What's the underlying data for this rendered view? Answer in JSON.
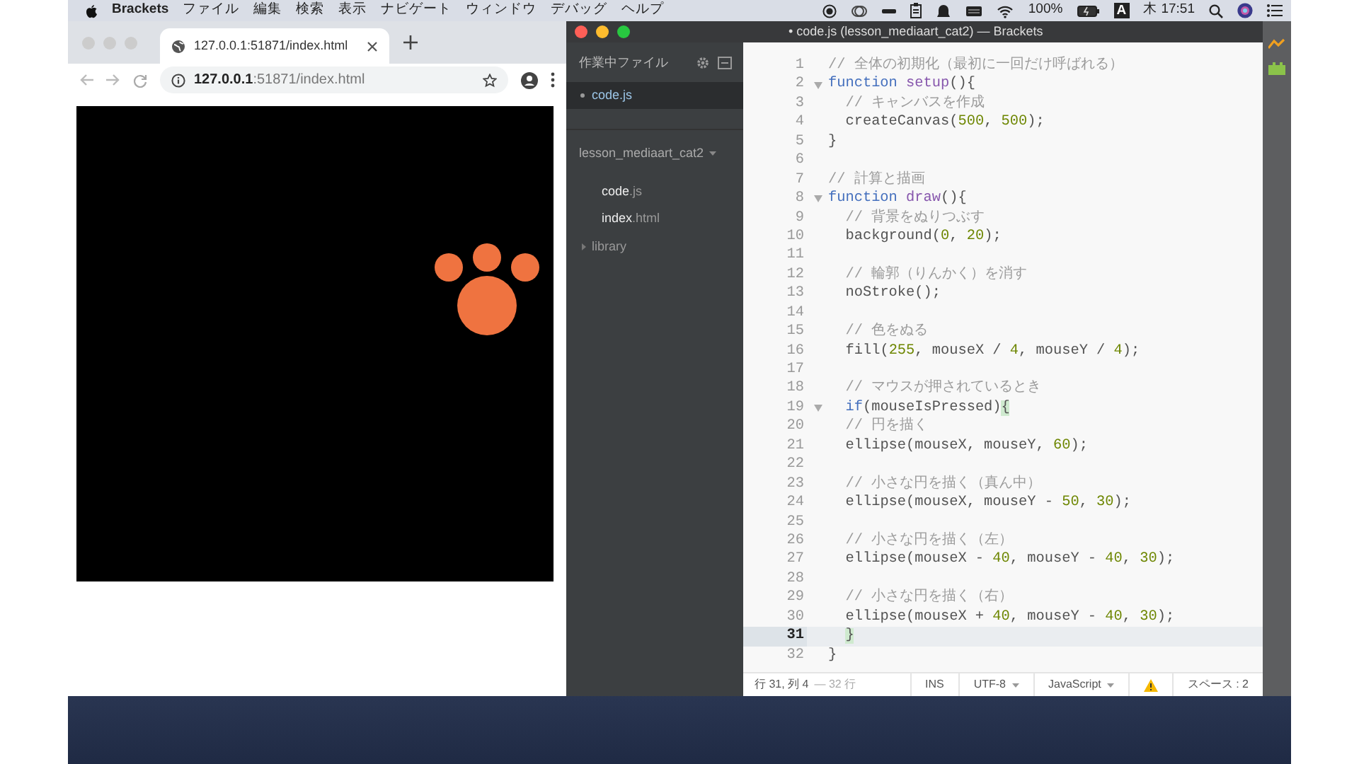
{
  "menu_bar": {
    "app": "Brackets",
    "items": [
      "ファイル",
      "編集",
      "検索",
      "表示",
      "ナビゲート",
      "ウィンドウ",
      "デバッグ",
      "ヘルプ"
    ],
    "battery": "100%",
    "input_source": "A",
    "clock": "木 17:51"
  },
  "browser": {
    "tabs": [
      {
        "title": "127.0.0.1:51871/index.html",
        "selected": true
      }
    ],
    "address": "**127.0.0.1**:51871/index.html"
  },
  "editor": {
    "title": "• code.js (lesson_mediaart_cat2) — Brackets",
    "working_files": {
      "header": "作業中ファイル",
      "files": [
        {
          "name": "code.js",
          "selected": true
        }
      ]
    },
    "project": {
      "name": "lesson_mediaart_cat2",
      "items": [
        {
          "kind": "file",
          "name": "code",
          "ext": ".js"
        },
        {
          "kind": "file",
          "name": "index",
          "ext": ".html"
        },
        {
          "kind": "folder",
          "name": "library",
          "expanded": false
        }
      ]
    },
    "lines": [
      {
        "number": "1",
        "foldable": false,
        "active": false,
        "tokens": [
          {
            "kind": "comment",
            "text": "// 全体の初期化（最初に一回だけ呼ばれる）"
          }
        ]
      },
      {
        "number": "2",
        "foldable": true,
        "active": false,
        "tokens": [
          {
            "kind": "keyword",
            "text": "function "
          },
          {
            "kind": "def",
            "text": "setup"
          },
          {
            "kind": "plain",
            "text": "(){"
          }
        ]
      },
      {
        "number": "3",
        "foldable": false,
        "active": false,
        "tokens": [
          {
            "kind": "comment",
            "text": "  // キャンバスを作成"
          }
        ]
      },
      {
        "number": "4",
        "foldable": false,
        "active": false,
        "tokens": [
          {
            "kind": "plain",
            "text": "  createCanvas("
          },
          {
            "kind": "number",
            "text": "500"
          },
          {
            "kind": "plain",
            "text": ", "
          },
          {
            "kind": "number",
            "text": "500"
          },
          {
            "kind": "plain",
            "text": ");"
          }
        ]
      },
      {
        "number": "5",
        "foldable": false,
        "active": false,
        "tokens": [
          {
            "kind": "plain",
            "text": "}"
          }
        ]
      },
      {
        "number": "6",
        "foldable": false,
        "active": false
      },
      {
        "number": "7",
        "foldable": false,
        "active": false,
        "tokens": [
          {
            "kind": "comment",
            "text": "// 計算と描画"
          }
        ]
      },
      {
        "number": "8",
        "foldable": true,
        "active": false,
        "tokens": [
          {
            "kind": "keyword",
            "text": "function "
          },
          {
            "kind": "def",
            "text": "draw"
          },
          {
            "kind": "plain",
            "text": "(){"
          }
        ]
      },
      {
        "number": "9",
        "foldable": false,
        "active": false,
        "tokens": [
          {
            "kind": "comment",
            "text": "  // 背景をぬりつぶす"
          }
        ]
      },
      {
        "number": "10",
        "foldable": false,
        "active": false,
        "tokens": [
          {
            "kind": "plain",
            "text": "  background("
          },
          {
            "kind": "number",
            "text": "0"
          },
          {
            "kind": "plain",
            "text": ", "
          },
          {
            "kind": "number",
            "text": "20"
          },
          {
            "kind": "plain",
            "text": ");"
          }
        ]
      },
      {
        "number": "11",
        "foldable": false,
        "active": false
      },
      {
        "number": "12",
        "foldable": false,
        "active": false,
        "tokens": [
          {
            "kind": "comment",
            "text": "  // 輪郭（りんかく）を消す"
          }
        ]
      },
      {
        "number": "13",
        "foldable": false,
        "active": false,
        "tokens": [
          {
            "kind": "plain",
            "text": "  noStroke();"
          }
        ]
      },
      {
        "number": "14",
        "foldable": false,
        "active": false
      },
      {
        "number": "15",
        "foldable": false,
        "active": false,
        "tokens": [
          {
            "kind": "comment",
            "text": "  // 色をぬる"
          }
        ]
      },
      {
        "number": "16",
        "foldable": false,
        "active": false,
        "tokens": [
          {
            "kind": "plain",
            "text": "  fill("
          },
          {
            "kind": "number",
            "text": "255"
          },
          {
            "kind": "plain",
            "text": ", mouseX / "
          },
          {
            "kind": "number",
            "text": "4"
          },
          {
            "kind": "plain",
            "text": ", mouseY / "
          },
          {
            "kind": "number",
            "text": "4"
          },
          {
            "kind": "plain",
            "text": ");"
          }
        ]
      },
      {
        "number": "17",
        "foldable": false,
        "active": false
      },
      {
        "number": "18",
        "foldable": false,
        "active": false,
        "tokens": [
          {
            "kind": "comment",
            "text": "  // マウスが押されているとき"
          }
        ]
      },
      {
        "number": "19",
        "foldable": true,
        "active": false,
        "tokens": [
          {
            "kind": "keyword",
            "text": "  if"
          },
          {
            "kind": "plain",
            "text": "(mouseIsPressed)"
          },
          {
            "kind": "match",
            "text": "{"
          }
        ]
      },
      {
        "number": "20",
        "foldable": false,
        "active": false,
        "tokens": [
          {
            "kind": "comment",
            "text": "  // 円を描く"
          }
        ]
      },
      {
        "number": "21",
        "foldable": false,
        "active": false,
        "tokens": [
          {
            "kind": "plain",
            "text": "  ellipse(mouseX, mouseY, "
          },
          {
            "kind": "number",
            "text": "60"
          },
          {
            "kind": "plain",
            "text": ");"
          }
        ]
      },
      {
        "number": "22",
        "foldable": false,
        "active": false
      },
      {
        "number": "23",
        "foldable": false,
        "active": false,
        "tokens": [
          {
            "kind": "comment",
            "text": "  // 小さな円を描く（真ん中）"
          }
        ]
      },
      {
        "number": "24",
        "foldable": false,
        "active": false,
        "tokens": [
          {
            "kind": "plain",
            "text": "  ellipse(mouseX, mouseY - "
          },
          {
            "kind": "number",
            "text": "50"
          },
          {
            "kind": "plain",
            "text": ", "
          },
          {
            "kind": "number",
            "text": "30"
          },
          {
            "kind": "plain",
            "text": ");"
          }
        ]
      },
      {
        "number": "25",
        "foldable": false,
        "active": false
      },
      {
        "number": "26",
        "foldable": false,
        "active": false,
        "tokens": [
          {
            "kind": "comment",
            "text": "  // 小さな円を描く（左）"
          }
        ]
      },
      {
        "number": "27",
        "foldable": false,
        "active": false,
        "tokens": [
          {
            "kind": "plain",
            "text": "  ellipse(mouseX - "
          },
          {
            "kind": "number",
            "text": "40"
          },
          {
            "kind": "plain",
            "text": ", mouseY - "
          },
          {
            "kind": "number",
            "text": "40"
          },
          {
            "kind": "plain",
            "text": ", "
          },
          {
            "kind": "number",
            "text": "30"
          },
          {
            "kind": "plain",
            "text": ");"
          }
        ]
      },
      {
        "number": "28",
        "foldable": false,
        "active": false
      },
      {
        "number": "29",
        "foldable": false,
        "active": false,
        "tokens": [
          {
            "kind": "comment",
            "text": "  // 小さな円を描く（右）"
          }
        ]
      },
      {
        "number": "30",
        "foldable": false,
        "active": false,
        "tokens": [
          {
            "kind": "plain",
            "text": "  ellipse(mouseX + "
          },
          {
            "kind": "number",
            "text": "40"
          },
          {
            "kind": "plain",
            "text": ", mouseY - "
          },
          {
            "kind": "number",
            "text": "40"
          },
          {
            "kind": "plain",
            "text": ", "
          },
          {
            "kind": "number",
            "text": "30"
          },
          {
            "kind": "plain",
            "text": ");"
          }
        ]
      },
      {
        "number": "31",
        "foldable": false,
        "active": true,
        "tokens": [
          {
            "kind": "match",
            "text": "  }"
          }
        ]
      },
      {
        "number": "32",
        "foldable": false,
        "active": false,
        "tokens": [
          {
            "kind": "plain",
            "text": "}"
          }
        ]
      }
    ],
    "status_bar": {
      "position": "行 31, 列 4",
      "line_count": "— 32 行",
      "mode": "INS",
      "encoding": "UTF-8",
      "language": "JavaScript",
      "indent": "スペース : 2"
    }
  }
}
